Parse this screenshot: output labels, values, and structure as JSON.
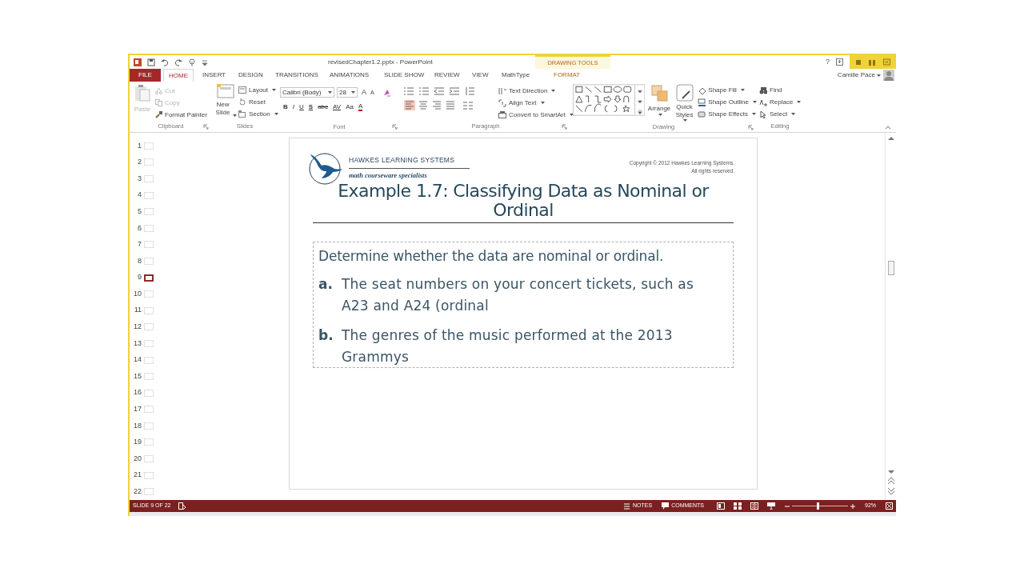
{
  "window": {
    "title": "revisedChapter1.2.pptx - PowerPoint",
    "context_tab": "DRAWING TOOLS",
    "help": "?"
  },
  "tabs": [
    {
      "label": "FILE",
      "kind": "file",
      "selected": false
    },
    {
      "label": "HOME",
      "kind": "tab",
      "selected": true
    },
    {
      "label": "INSERT",
      "kind": "tab",
      "selected": false
    },
    {
      "label": "DESIGN",
      "kind": "tab",
      "selected": false
    },
    {
      "label": "TRANSITIONS",
      "kind": "tab",
      "selected": false
    },
    {
      "label": "ANIMATIONS",
      "kind": "tab",
      "selected": false
    },
    {
      "label": "SLIDE SHOW",
      "kind": "tab",
      "selected": false
    },
    {
      "label": "REVIEW",
      "kind": "tab",
      "selected": false
    },
    {
      "label": "VIEW",
      "kind": "tab",
      "selected": false
    },
    {
      "label": "MathType",
      "kind": "tab",
      "selected": false
    },
    {
      "label": "FORMAT",
      "kind": "context",
      "selected": false
    }
  ],
  "user": "Camille Pace",
  "ribbon": {
    "clipboard": {
      "label": "Clipboard",
      "items": [
        {
          "label": "Paste",
          "disabled": true
        },
        {
          "label": "Cut",
          "disabled": true
        },
        {
          "label": "Copy",
          "disabled": true
        },
        {
          "label": "Format Painter",
          "disabled": false
        }
      ]
    },
    "slides": {
      "label": "Slides",
      "new_slide": "New Slide",
      "commands": [
        {
          "label": "Layout",
          "dropdown": true
        },
        {
          "label": "Reset",
          "dropdown": false
        },
        {
          "label": "Section",
          "dropdown": true
        }
      ]
    },
    "font": {
      "label": "Font",
      "font_name": "Calibri (Body)",
      "font_size": "28",
      "size_buttons": [
        "A",
        "A"
      ],
      "buttons": [
        "B",
        "I",
        "U",
        "S",
        "abc",
        "AV",
        "Aa",
        "A"
      ]
    },
    "paragraph": {
      "label": "Paragraph",
      "alignments": [
        {
          "selected": true
        },
        {
          "selected": false
        },
        {
          "selected": false
        },
        {
          "selected": false
        }
      ],
      "commands": [
        {
          "label": "Text Direction",
          "dropdown": true
        },
        {
          "label": "Align Text",
          "dropdown": true
        },
        {
          "label": "Convert to SmartArt",
          "dropdown": true
        }
      ]
    },
    "drawing": {
      "label": "Drawing",
      "arrange": "Arrange",
      "quick_styles": "Quick Styles",
      "commands": [
        {
          "label": "Shape Fill",
          "dropdown": true
        },
        {
          "label": "Shape Outline",
          "dropdown": true
        },
        {
          "label": "Shape Effects",
          "dropdown": true
        }
      ]
    },
    "editing": {
      "label": "Editing",
      "commands": [
        {
          "label": "Find",
          "dropdown": false
        },
        {
          "label": "Replace",
          "dropdown": true
        },
        {
          "label": "Select",
          "dropdown": true
        }
      ]
    }
  },
  "thumbnails": [
    {
      "number": "1",
      "selected": false
    },
    {
      "number": "2",
      "selected": false
    },
    {
      "number": "3",
      "selected": false
    },
    {
      "number": "4",
      "selected": false
    },
    {
      "number": "5",
      "selected": false
    },
    {
      "number": "6",
      "selected": false
    },
    {
      "number": "7",
      "selected": false
    },
    {
      "number": "8",
      "selected": false
    },
    {
      "number": "9",
      "selected": true
    },
    {
      "number": "10",
      "selected": false
    },
    {
      "number": "11",
      "selected": false
    },
    {
      "number": "12",
      "selected": false
    },
    {
      "number": "13",
      "selected": false
    },
    {
      "number": "14",
      "selected": false
    },
    {
      "number": "15",
      "selected": false
    },
    {
      "number": "16",
      "selected": false
    },
    {
      "number": "17",
      "selected": false
    },
    {
      "number": "18",
      "selected": false
    },
    {
      "number": "19",
      "selected": false
    },
    {
      "number": "20",
      "selected": false
    },
    {
      "number": "21",
      "selected": false
    },
    {
      "number": "22",
      "selected": false
    }
  ],
  "slide": {
    "brand": "HAWKES LEARNING SYSTEMS",
    "tagline": "math courseware specialists",
    "copyright": [
      "Copyright © 2012 Hawkes Learning Systems.",
      "All rights reserved."
    ],
    "title": "Example 1.7: Classifying Data as Nominal or Ordinal",
    "intro": "Determine whether the data are nominal or ordinal.",
    "items": [
      {
        "marker": "a.",
        "text": "The seat numbers on your concert tickets, such as A23 and A24 (ordinal"
      },
      {
        "marker": "b.",
        "text": "The genres of the music performed at the 2013 Grammys"
      }
    ]
  },
  "status": {
    "slide": "SLIDE 9 OF 22",
    "notes": "NOTES",
    "comments": "COMMENTS",
    "zoom": {
      "level": 0.46
    },
    "zoom_reading": "92%"
  }
}
